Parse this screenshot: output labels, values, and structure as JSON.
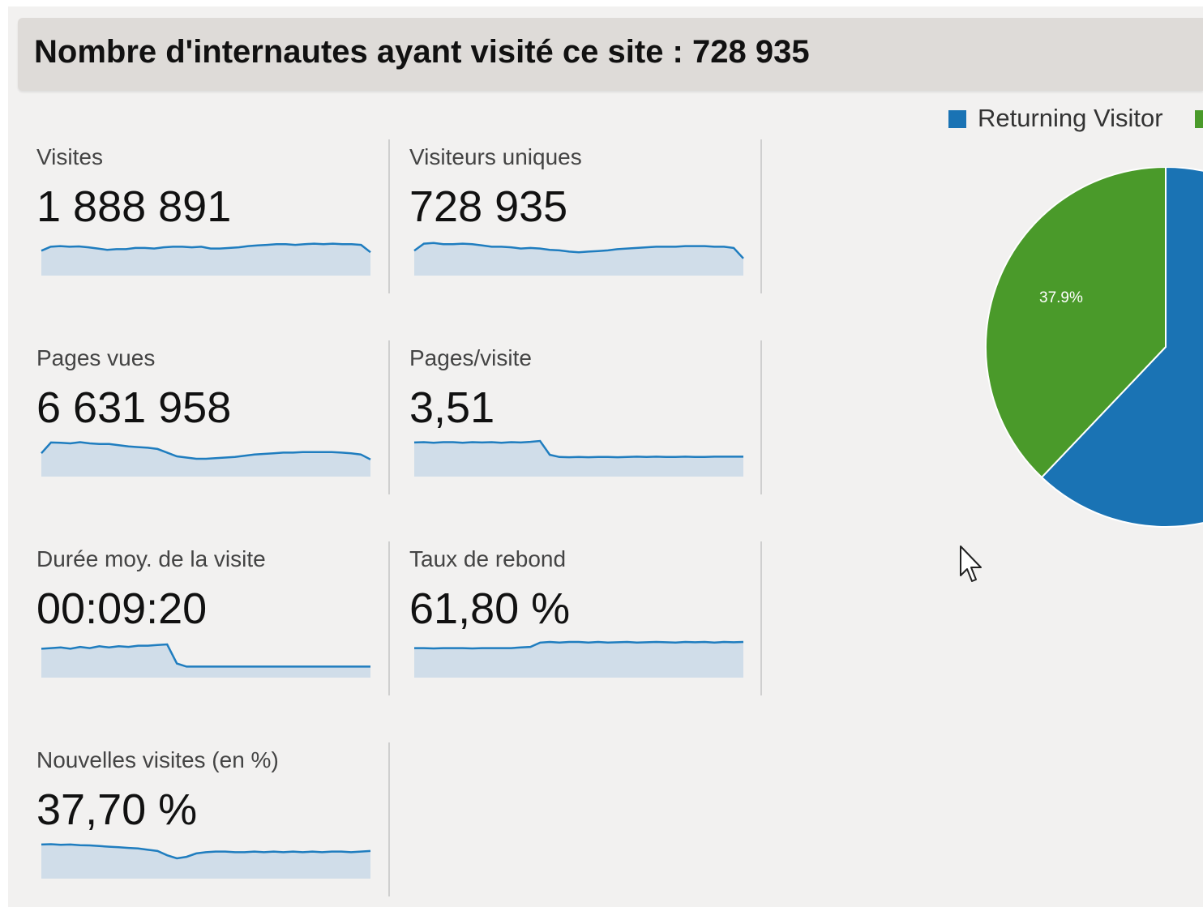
{
  "header": {
    "title": "Nombre d'internautes ayant visité ce site : 728 935"
  },
  "metrics": [
    {
      "label": "Visites",
      "value": "1 888 891",
      "spark": [
        0.65,
        0.78,
        0.8,
        0.78,
        0.79,
        0.76,
        0.72,
        0.68,
        0.7,
        0.7,
        0.74,
        0.74,
        0.72,
        0.76,
        0.78,
        0.78,
        0.76,
        0.78,
        0.72,
        0.72,
        0.74,
        0.76,
        0.8,
        0.82,
        0.84,
        0.86,
        0.86,
        0.84,
        0.86,
        0.88,
        0.86,
        0.88,
        0.86,
        0.86,
        0.84,
        0.6
      ]
    },
    {
      "label": "Visiteurs uniques",
      "value": "728 935",
      "spark": [
        0.65,
        0.88,
        0.9,
        0.86,
        0.86,
        0.88,
        0.86,
        0.82,
        0.78,
        0.78,
        0.76,
        0.72,
        0.74,
        0.72,
        0.68,
        0.66,
        0.62,
        0.6,
        0.62,
        0.64,
        0.66,
        0.7,
        0.72,
        0.74,
        0.76,
        0.78,
        0.78,
        0.78,
        0.8,
        0.8,
        0.8,
        0.78,
        0.78,
        0.74,
        0.4
      ]
    },
    {
      "label": "Pages vues",
      "value": "6 631 958",
      "spark": [
        0.6,
        0.95,
        0.94,
        0.92,
        0.96,
        0.92,
        0.9,
        0.9,
        0.86,
        0.82,
        0.8,
        0.78,
        0.74,
        0.62,
        0.5,
        0.46,
        0.42,
        0.42,
        0.44,
        0.46,
        0.48,
        0.52,
        0.56,
        0.58,
        0.6,
        0.62,
        0.62,
        0.64,
        0.64,
        0.64,
        0.64,
        0.62,
        0.6,
        0.56,
        0.4
      ]
    },
    {
      "label": "Pages/visite",
      "value": "3,51",
      "spark": [
        0.95,
        0.96,
        0.94,
        0.96,
        0.96,
        0.94,
        0.96,
        0.95,
        0.96,
        0.94,
        0.96,
        0.95,
        0.97,
        1.0,
        0.55,
        0.48,
        0.47,
        0.48,
        0.47,
        0.48,
        0.48,
        0.47,
        0.48,
        0.49,
        0.48,
        0.49,
        0.48,
        0.48,
        0.49,
        0.48,
        0.48,
        0.49,
        0.49,
        0.49,
        0.49
      ]
    },
    {
      "label": "Durée moy. de la visite",
      "value": "00:09:20",
      "spark": [
        0.78,
        0.8,
        0.82,
        0.78,
        0.84,
        0.8,
        0.86,
        0.82,
        0.86,
        0.84,
        0.88,
        0.88,
        0.9,
        0.92,
        0.3,
        0.2,
        0.2,
        0.2,
        0.2,
        0.2,
        0.2,
        0.2,
        0.2,
        0.2,
        0.2,
        0.2,
        0.2,
        0.2,
        0.2,
        0.2,
        0.2,
        0.2,
        0.2,
        0.2,
        0.2
      ]
    },
    {
      "label": "Taux de rebond",
      "value": "61,80 %",
      "spark": [
        0.8,
        0.8,
        0.79,
        0.8,
        0.8,
        0.8,
        0.79,
        0.8,
        0.8,
        0.8,
        0.8,
        0.82,
        0.84,
        0.98,
        1.0,
        0.98,
        1.0,
        1.0,
        0.98,
        1.0,
        0.98,
        0.99,
        1.0,
        0.98,
        0.99,
        1.0,
        0.99,
        0.98,
        1.0,
        0.99,
        1.0,
        0.98,
        1.0,
        0.99,
        1.0
      ]
    },
    {
      "label": "Nouvelles visites (en %)",
      "value": "37,70 %",
      "spark": [
        0.95,
        0.96,
        0.94,
        0.95,
        0.93,
        0.92,
        0.9,
        0.88,
        0.86,
        0.84,
        0.82,
        0.78,
        0.74,
        0.6,
        0.5,
        0.55,
        0.66,
        0.7,
        0.72,
        0.72,
        0.7,
        0.7,
        0.72,
        0.7,
        0.72,
        0.7,
        0.72,
        0.7,
        0.72,
        0.7,
        0.72,
        0.72,
        0.7,
        0.72,
        0.74
      ]
    }
  ],
  "pie": {
    "legend": [
      {
        "label": "Returning Visitor",
        "color": "#1a73b4"
      },
      {
        "label": "",
        "color": "#4a9a2a"
      }
    ],
    "slice_label": "37.9%",
    "new_share_pct": 37.9,
    "colors": {
      "returning": "#1a73b4",
      "new": "#4a9a2a"
    }
  },
  "colors": {
    "spark_line": "#1f7dbf",
    "spark_fill": "#d0dde9"
  }
}
